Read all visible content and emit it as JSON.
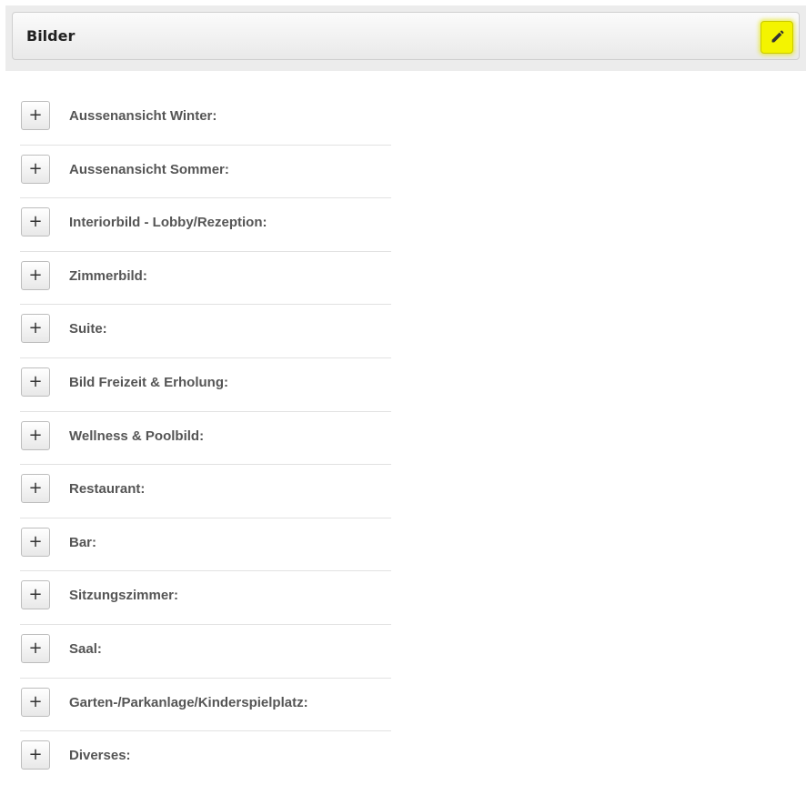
{
  "panel": {
    "title": "Bilder",
    "edit_icon": "pencil-icon",
    "edit_highlight_color": "#f4f400"
  },
  "image_categories": [
    {
      "label": "Aussenansicht Winter:",
      "action_icon": "plus-icon",
      "action_symbol": "+"
    },
    {
      "label": "Aussenansicht Sommer:",
      "action_icon": "plus-icon",
      "action_symbol": "+"
    },
    {
      "label": "Interiorbild - Lobby/Rezeption:",
      "action_icon": "plus-icon",
      "action_symbol": "+"
    },
    {
      "label": "Zimmerbild:",
      "action_icon": "plus-icon",
      "action_symbol": "+"
    },
    {
      "label": "Suite:",
      "action_icon": "plus-icon",
      "action_symbol": "+"
    },
    {
      "label": "Bild Freizeit & Erholung:",
      "action_icon": "plus-icon",
      "action_symbol": "+"
    },
    {
      "label": "Wellness & Poolbild:",
      "action_icon": "plus-icon",
      "action_symbol": "+"
    },
    {
      "label": "Restaurant:",
      "action_icon": "plus-icon",
      "action_symbol": "+"
    },
    {
      "label": "Bar:",
      "action_icon": "plus-icon",
      "action_symbol": "+"
    },
    {
      "label": "Sitzungszimmer:",
      "action_icon": "plus-icon",
      "action_symbol": "+"
    },
    {
      "label": "Saal:",
      "action_icon": "plus-icon",
      "action_symbol": "+"
    },
    {
      "label": "Garten-/Parkanlage/Kinderspielplatz:",
      "action_icon": "plus-icon",
      "action_symbol": "+"
    },
    {
      "label": "Diverses:",
      "action_icon": "plus-icon",
      "action_symbol": "+"
    }
  ]
}
